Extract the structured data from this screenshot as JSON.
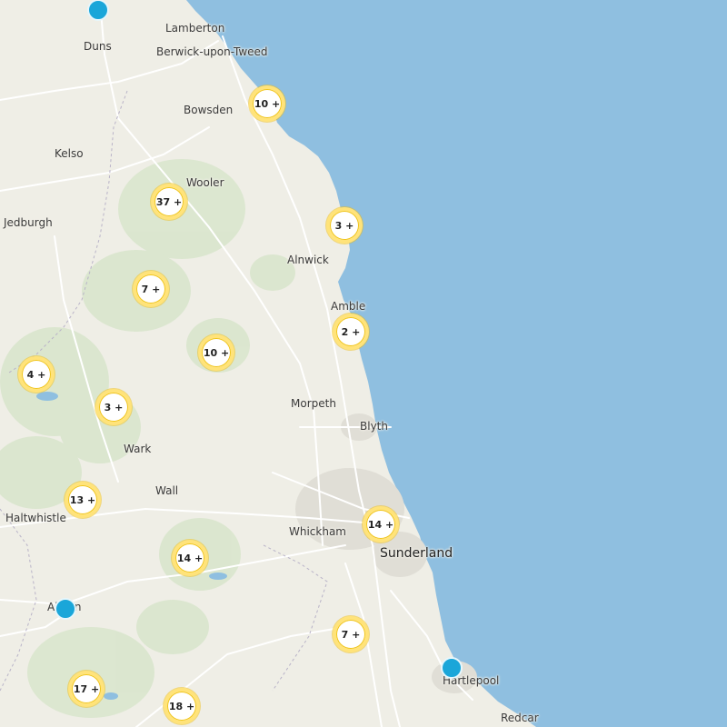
{
  "map": {
    "colors": {
      "sea": "#8fbfe0",
      "land": "#efeee6",
      "green": "#d9e8cf",
      "road": "#ffffff",
      "urban": "#e2e0d8",
      "cluster_ring": "#ffe37a",
      "pin": "#1aa6d9"
    },
    "places": [
      {
        "id": "duns",
        "name": "Duns"
      },
      {
        "id": "lamberton",
        "name": "Lamberton"
      },
      {
        "id": "berwick",
        "name": "Berwick-upon-Tweed"
      },
      {
        "id": "bowsden",
        "name": "Bowsden"
      },
      {
        "id": "kelso",
        "name": "Kelso"
      },
      {
        "id": "wooler",
        "name": "Wooler"
      },
      {
        "id": "jedburgh",
        "name": "Jedburgh"
      },
      {
        "id": "alnwick",
        "name": "Alnwick"
      },
      {
        "id": "amble",
        "name": "Amble"
      },
      {
        "id": "morpeth",
        "name": "Morpeth"
      },
      {
        "id": "blyth",
        "name": "Blyth"
      },
      {
        "id": "wark",
        "name": "Wark"
      },
      {
        "id": "wall",
        "name": "Wall"
      },
      {
        "id": "haltwhistle",
        "name": "Haltwhistle"
      },
      {
        "id": "whickham",
        "name": "Whickham"
      },
      {
        "id": "sunderland",
        "name": "Sunderland"
      },
      {
        "id": "alston",
        "name": "Alston"
      },
      {
        "id": "hartlepool",
        "name": "Hartlepool"
      },
      {
        "id": "redcar",
        "name": "Redcar"
      }
    ],
    "clusters": [
      {
        "id": "c1",
        "label": "10 +"
      },
      {
        "id": "c2",
        "label": "37 +"
      },
      {
        "id": "c3",
        "label": "3 +"
      },
      {
        "id": "c4",
        "label": "7 +"
      },
      {
        "id": "c5",
        "label": "2 +"
      },
      {
        "id": "c6",
        "label": "10 +"
      },
      {
        "id": "c7",
        "label": "4 +"
      },
      {
        "id": "c8",
        "label": "3 +"
      },
      {
        "id": "c9",
        "label": "13 +"
      },
      {
        "id": "c10",
        "label": "14 +"
      },
      {
        "id": "c11",
        "label": "14 +"
      },
      {
        "id": "c12",
        "label": "7 +"
      },
      {
        "id": "c13",
        "label": "17 +"
      },
      {
        "id": "c14",
        "label": "18 +"
      }
    ],
    "pins": [
      {
        "id": "p1"
      },
      {
        "id": "p2"
      },
      {
        "id": "p3"
      }
    ]
  }
}
